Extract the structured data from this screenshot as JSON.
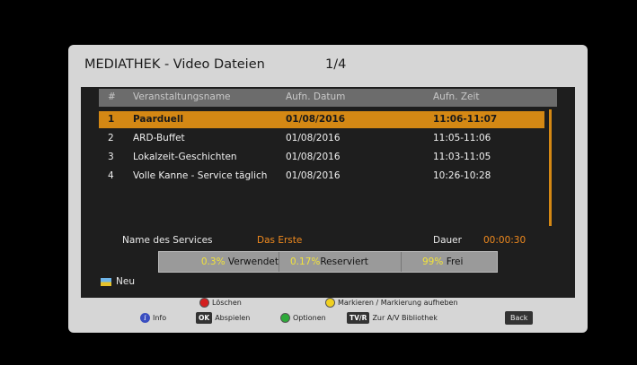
{
  "window": {
    "title": "MEDIATHEK - Video Dateien",
    "page": "1/4"
  },
  "table": {
    "headers": {
      "num": "#",
      "name": "Veranstaltungsname",
      "date": "Aufn. Datum",
      "time": "Aufn. Zeit"
    },
    "rows": [
      {
        "num": "1",
        "name": "Paarduell",
        "date": "01/08/2016",
        "time": "11:06-11:07",
        "selected": true
      },
      {
        "num": "2",
        "name": "ARD-Buffet",
        "date": "01/08/2016",
        "time": "11:05-11:06"
      },
      {
        "num": "3",
        "name": "Lokalzeit-Geschichten",
        "date": "01/08/2016",
        "time": "11:03-11:05"
      },
      {
        "num": "4",
        "name": "Volle Kanne - Service täglich",
        "date": "01/08/2016",
        "time": "10:26-10:28"
      }
    ]
  },
  "service": {
    "label": "Name des Services",
    "value": "Das Erste",
    "duration_label": "Dauer",
    "duration_value": "00:00:30"
  },
  "storage": {
    "used_pct": "0.3%",
    "used_label": "Verwendet",
    "reserved_pct": "0.17%",
    "reserved_label": "Reserviert",
    "free_pct": "99%",
    "free_label": "Frei"
  },
  "new_marker": "Neu",
  "legend": {
    "delete": "Löschen",
    "mark": "Markieren / Markierung aufheben",
    "info": "Info",
    "ok_key": "OK",
    "play": "Abspielen",
    "options": "Optionen",
    "tvr_key": "TV/R",
    "library": "Zur A/V Bibliothek",
    "back": "Back"
  },
  "colors": {
    "accent": "#d48814",
    "red": "#d42020",
    "yellow": "#f0d020",
    "green": "#2eaa3a",
    "blue": "#3a4ec0"
  }
}
